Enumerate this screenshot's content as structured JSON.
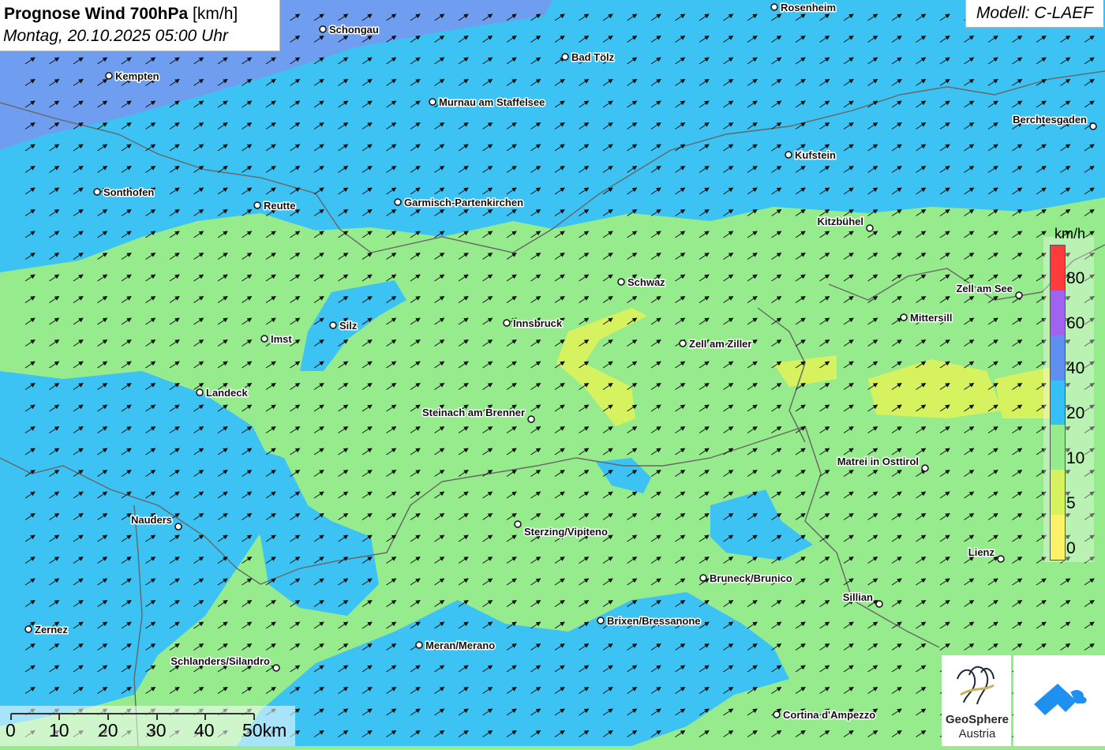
{
  "title": {
    "main_bold": "Prognose Wind 700hPa",
    "unit": "[km/h]",
    "date": "Montag, 20.10.2025 05:00 Uhr"
  },
  "model": "Modell: C-LAEF",
  "legend": {
    "unit": "km/h",
    "labels": [
      "80",
      "60",
      "40",
      "20",
      "10",
      "5",
      "0"
    ],
    "colors": [
      "#ff3b3b",
      "#9f63f0",
      "#5f8ff0",
      "#36c0f5",
      "#96ec8c",
      "#d6f25e",
      "#fbf26a"
    ]
  },
  "scale": {
    "ticks": [
      "0",
      "10",
      "20",
      "30",
      "40",
      "50km"
    ]
  },
  "logo": {
    "name": "GeoSphere",
    "sub": "Austria"
  },
  "cities": [
    {
      "name": "Rosenheim"
    },
    {
      "name": "Schongau"
    },
    {
      "name": "Bad Tölz"
    },
    {
      "name": "Kempten"
    },
    {
      "name": "Murnau am Staffelsee"
    },
    {
      "name": "Berchtesgaden"
    },
    {
      "name": "Kufstein"
    },
    {
      "name": "Sonthofen"
    },
    {
      "name": "Reutte"
    },
    {
      "name": "Garmisch-Partenkirchen"
    },
    {
      "name": "Kitzbühel"
    },
    {
      "name": "Schwaz"
    },
    {
      "name": "Zell am See"
    },
    {
      "name": "Mittersill"
    },
    {
      "name": "Innsbruck"
    },
    {
      "name": "Silz"
    },
    {
      "name": "Imst"
    },
    {
      "name": "Zell am Ziller"
    },
    {
      "name": "Landeck"
    },
    {
      "name": "Steinach am Brenner"
    },
    {
      "name": "Matrei in Osttirol"
    },
    {
      "name": "Nauders"
    },
    {
      "name": "Sterzing/Vipiteno"
    },
    {
      "name": "Lienz"
    },
    {
      "name": "Bruneck/Brunico"
    },
    {
      "name": "Sillian"
    },
    {
      "name": "Brixen/Bressanone"
    },
    {
      "name": "Zernez"
    },
    {
      "name": "Meran/Merano"
    },
    {
      "name": "Schlanders/Silandro"
    },
    {
      "name": "Cortina d'Ampezzo"
    }
  ],
  "colors": {
    "blue_dark": "#6f9ef0",
    "blue": "#3cc3f3",
    "green": "#96ec8c",
    "yellow": "#d6f25e"
  }
}
